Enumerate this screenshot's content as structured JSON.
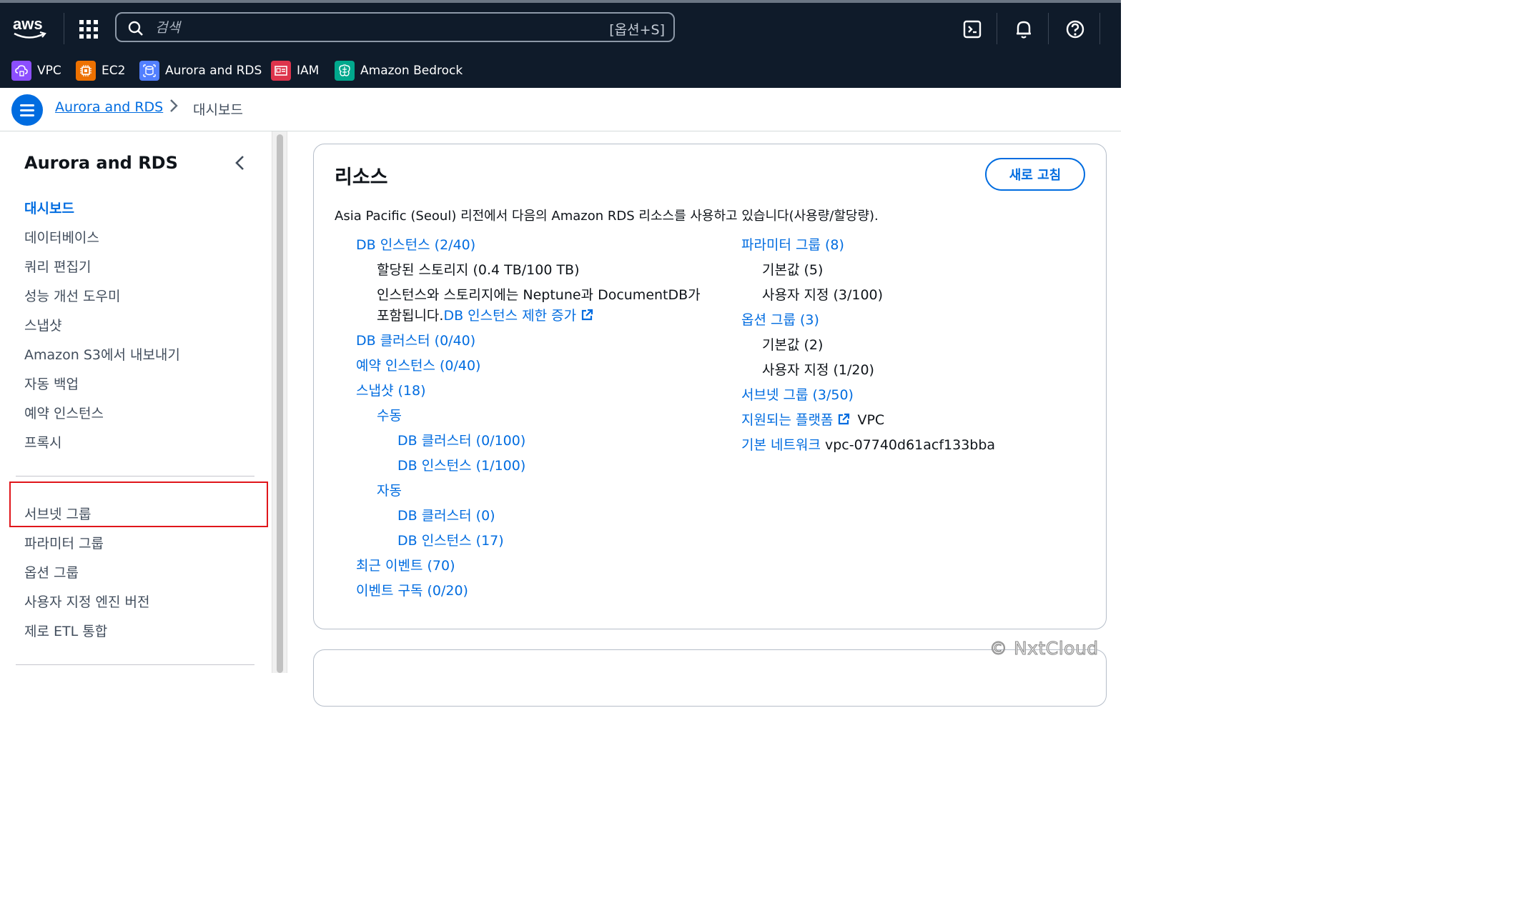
{
  "topbar": {
    "logo_text": "aws",
    "search_placeholder": "검색",
    "search_shortcut": "[옵션+S]"
  },
  "favorites": [
    {
      "label": "VPC",
      "color": "#8c4fff"
    },
    {
      "label": "EC2",
      "color": "#ed7100"
    },
    {
      "label": "Aurora and RDS",
      "color": "#527fff"
    },
    {
      "label": "IAM",
      "color": "#dd344c"
    },
    {
      "label": "Amazon Bedrock",
      "color": "#01a88d"
    }
  ],
  "breadcrumb": {
    "parent": "Aurora and RDS",
    "current": "대시보드"
  },
  "sidenav": {
    "title": "Aurora and RDS",
    "items": [
      "대시보드",
      "데이터베이스",
      "쿼리 편집기",
      "성능 개선 도우미",
      "스냅샷",
      "Amazon S3에서 내보내기",
      "자동 백업",
      "예약 인스턴스",
      "프록시"
    ],
    "items2": [
      "서브넷 그룹",
      "파라미터 그룹",
      "옵션 그룹",
      "사용자 지정 엔진 버전",
      "제로 ETL 통합"
    ]
  },
  "resources": {
    "title": "리소스",
    "refresh": "새로 고침",
    "description": "Asia Pacific (Seoul) 리전에서 다음의 Amazon RDS 리소스를 사용하고 있습니다(사용량/할당량).",
    "db_instances": "DB 인스턴스 (2/40)",
    "allocated_storage": "할당된 스토리지 (0.4 TB/100 TB)",
    "note_line1": "인스턴스와 스토리지에는 Neptune과 DocumentDB가",
    "note_line2": "포함됩니다.",
    "increase_limit": "DB 인스턴스 제한 증가",
    "db_clusters": "DB 클러스터 (0/40)",
    "reserved": "예약 인스턴스 (0/40)",
    "snapshots": "스냅샷 (18)",
    "manual": "수동",
    "manual_clusters": "DB 클러스터 (0/100)",
    "manual_instances": "DB 인스턴스 (1/100)",
    "automated": "자동",
    "auto_clusters": "DB 클러스터 (0)",
    "auto_instances": "DB 인스턴스 (17)",
    "recent_events": "최근 이벤트 (70)",
    "event_subs": "이벤트 구독 (0/20)",
    "param_groups": "파라미터 그룹 (8)",
    "param_default": "기본값 (5)",
    "param_custom": "사용자 지정 (3/100)",
    "option_groups": "옵션 그룹 (3)",
    "option_default": "기본값 (2)",
    "option_custom": "사용자 지정 (1/20)",
    "subnet_groups": "서브넷 그룹 (3/50)",
    "supported_platforms": "지원되는 플랫폼",
    "platform_value": "VPC",
    "default_network": "기본 네트워크",
    "network_value": "vpc-07740d61acf133bba"
  },
  "watermark": "© NxtCloud"
}
